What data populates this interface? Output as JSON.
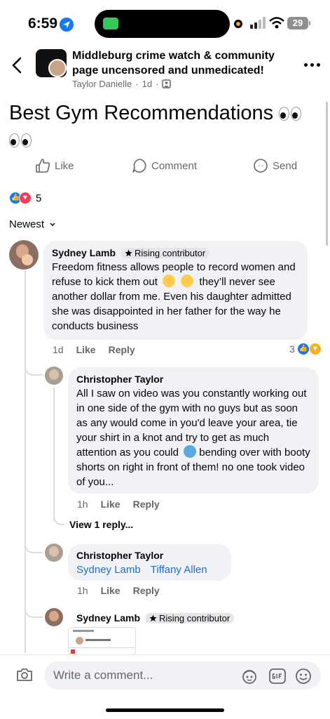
{
  "status_bar": {
    "time": "6:59",
    "battery": "29"
  },
  "group": {
    "name": "Middleburg crime watch & community page uncensored and unmedicated!",
    "author": "Taylor Danielle",
    "age": "1d",
    "separator": "·"
  },
  "post": {
    "title": "Best Gym Recommendations"
  },
  "actions": {
    "like": "Like",
    "comment": "Comment",
    "send": "Send"
  },
  "reactions": {
    "count": "5"
  },
  "sort": {
    "label": "Newest"
  },
  "comments": [
    {
      "name": "Sydney Lamb",
      "badge": "Rising contributor",
      "text_1": "Freedom fitness allows people to record women and refuse to kick them out",
      "text_2": "they’ll never see another dollar from me. Even his daughter admitted she was disappointed in her father for the way he conducts business",
      "time": "1d",
      "like": "Like",
      "reply": "Reply",
      "reaction_count": "3",
      "replies": [
        {
          "name": "Christopher Taylor",
          "text": "All I saw on video was you constantly working out in one side of the gym with no guys but as soon as any would come in you'd leave your area,  tie your shirt in a knot and try to get as much attention as you could",
          "text_2": "bending over with booty shorts on right in front of them! no one took video of you...",
          "time": "1h",
          "like": "Like",
          "reply": "Reply",
          "view_replies": "View 1 reply..."
        },
        {
          "name": "Christopher Taylor",
          "tags": [
            "Sydney Lamb",
            "Tiffany Allen"
          ],
          "time": "1h",
          "like": "Like",
          "reply": "Reply"
        },
        {
          "name": "Sydney Lamb",
          "badge": "Rising contributor"
        }
      ]
    }
  ],
  "composer": {
    "placeholder": "Write a comment..."
  },
  "colors": {
    "accent": "#1877f2",
    "love": "#f33e58",
    "bubble": "#f0f2f5",
    "muted": "#65676b"
  }
}
